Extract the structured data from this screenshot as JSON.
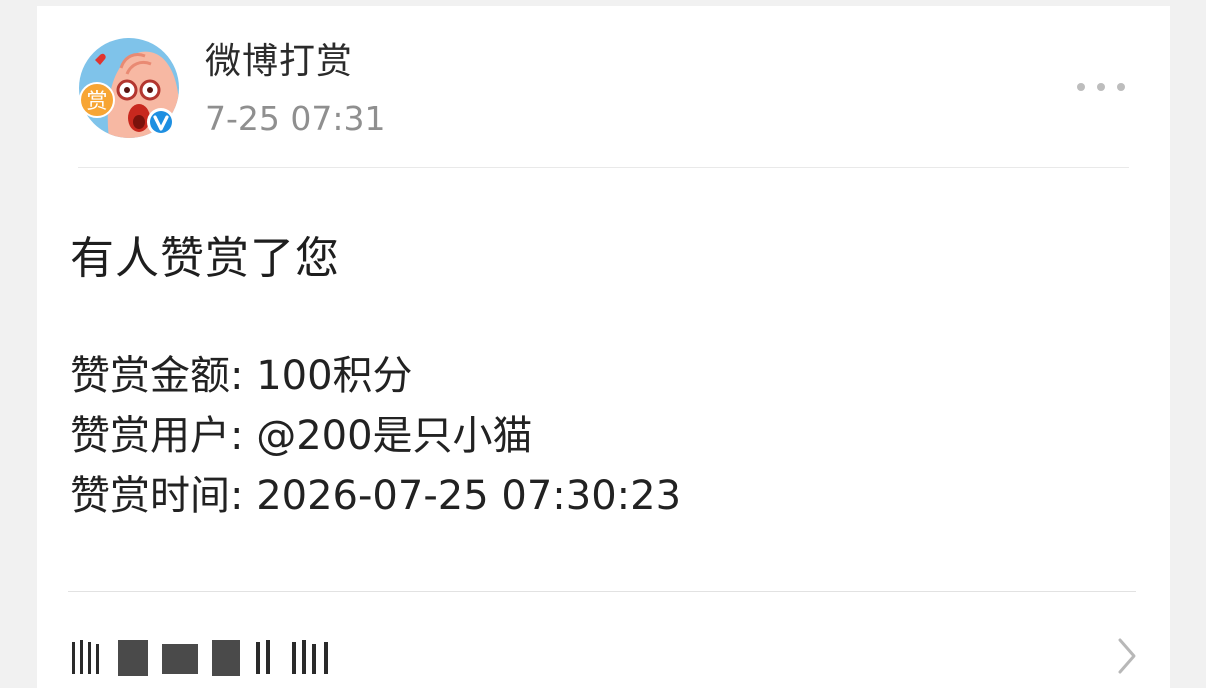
{
  "account": {
    "name": "微博打赏",
    "post_time": "7-25 07:31",
    "avatar_badge_text": "赏",
    "verified_icon": "verified-v-icon",
    "avatar_colors": {
      "background": "#7fc3ea",
      "badge": "#f7a534",
      "face": "#f7b8a3",
      "verified": "#1e8fe1"
    }
  },
  "menu": {
    "icon": "more-dots-icon"
  },
  "message": {
    "headline": "有人赞赏了您",
    "details": [
      "赞赏金额: 100积分",
      "赞赏用户: @200是只小猫",
      "赞赏时间: 2026-07-25 07:30:23"
    ]
  },
  "footer": {
    "link_icon": "chevron-right-icon",
    "link_text_state": "redacted"
  }
}
